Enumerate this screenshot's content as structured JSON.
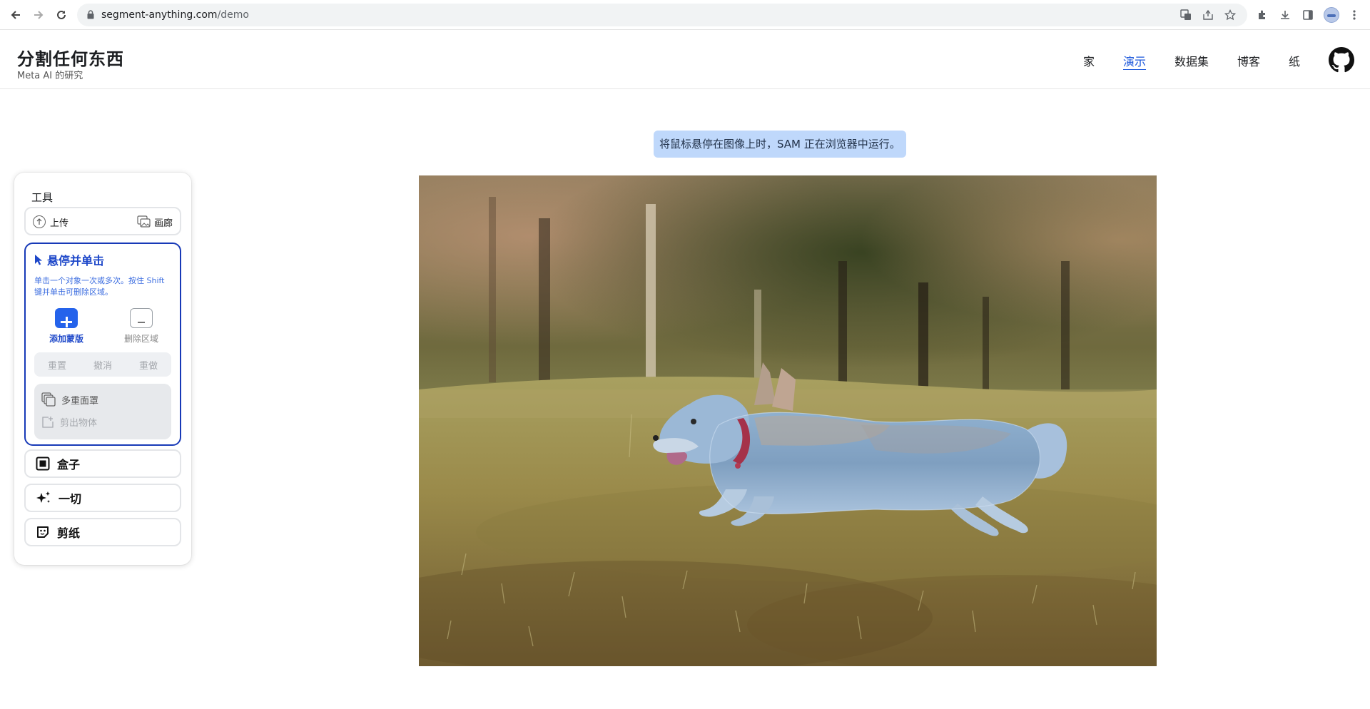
{
  "browser": {
    "url_host": "segment-anything.com",
    "url_path": "/demo"
  },
  "header": {
    "title": "分割任何东西",
    "subtitle": "Meta AI 的研究",
    "nav": [
      "家",
      "演示",
      "数据集",
      "博客",
      "纸"
    ],
    "active_nav": "演示"
  },
  "hint": "将鼠标悬停在图像上时，SAM 正在浏览器中运行。",
  "tools": {
    "title": "工具",
    "upload": "上传",
    "gallery": "画廊",
    "hover_click": {
      "title": "悬停并单击",
      "description": "单击一个对象一次或多次。按住 Shift 键并单击可删除区域。",
      "add_mask": "添加蒙版",
      "remove_area": "删除区域",
      "reset": "重置",
      "undo": "撤消",
      "redo": "重做",
      "multi_mask": "多重面罩",
      "cut_out": "剪出物体"
    },
    "box": "盒子",
    "everything": "一切",
    "cutouts": "剪纸"
  },
  "colors": {
    "accent": "#1d47c9",
    "hint_bg": "#bfd8fb",
    "mask_overlay": "#8fb3e6"
  },
  "image": {
    "subject": "corgi running on grass"
  }
}
